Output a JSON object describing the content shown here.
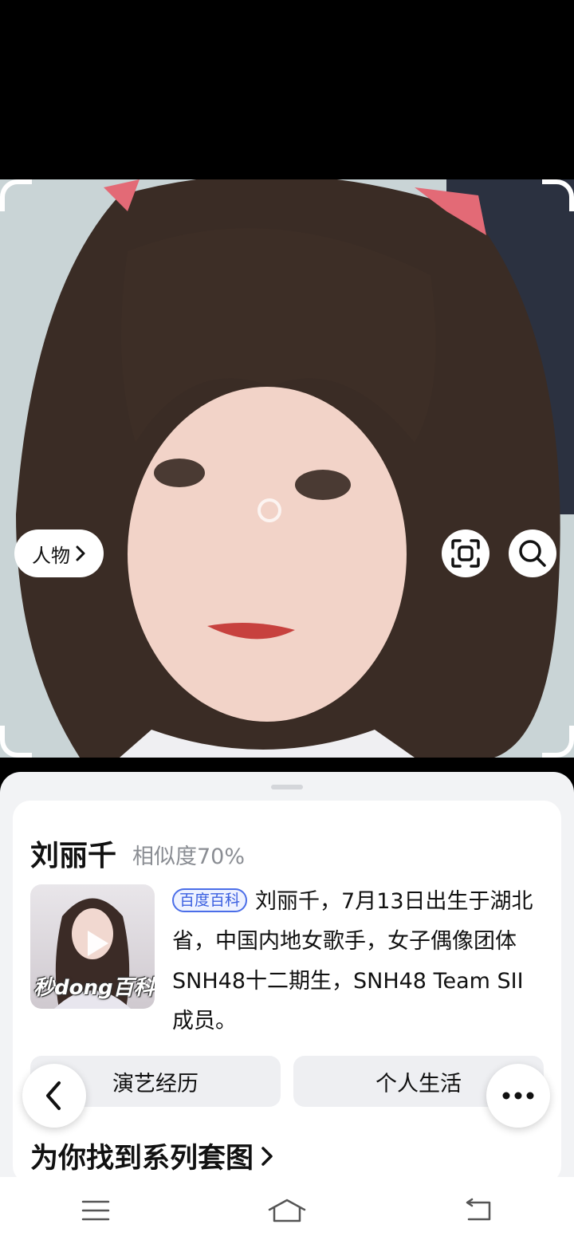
{
  "photo": {
    "category_label": "人物"
  },
  "result": {
    "name": "刘丽千",
    "similarity": "相似度70%",
    "video_logo": "秒dong百科",
    "source_tag": "百度百科",
    "description": "刘丽千，7月13日出生于湖北省，中国内地女歌手，女子偶像团体SNH48十二期生，SNH48 Team SII成员。",
    "tabs": [
      "演艺经历",
      "个人生活"
    ],
    "series_title": "为你找到系列套图"
  },
  "colors": {
    "accent": "#3a5fe0",
    "sheet_bg": "#f2f3f5"
  }
}
